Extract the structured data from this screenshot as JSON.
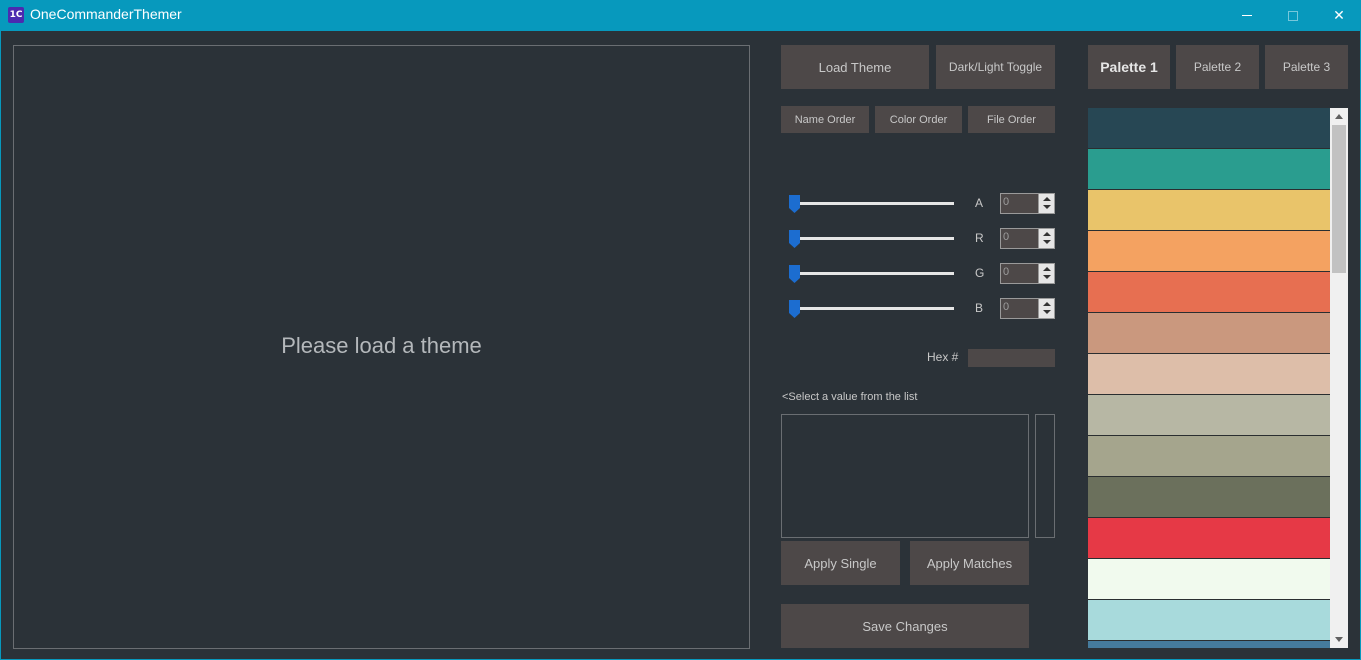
{
  "titlebar": {
    "app_icon_text": "1C",
    "title": "OneCommanderThemer",
    "close_glyph": "✕"
  },
  "preview": {
    "message": "Please load a theme"
  },
  "toolbar": {
    "load_theme": "Load Theme",
    "dark_light_toggle": "Dark/Light Toggle",
    "name_order": "Name Order",
    "color_order": "Color Order",
    "file_order": "File Order"
  },
  "sliders": {
    "a_label": "A",
    "a_value": "0",
    "r_label": "R",
    "r_value": "0",
    "g_label": "G",
    "g_value": "0",
    "b_label": "B",
    "b_value": "0"
  },
  "hex": {
    "label": "Hex #",
    "value": ""
  },
  "list": {
    "hint": "<Select a value from the list"
  },
  "actions": {
    "apply_single": "Apply Single",
    "apply_matches": "Apply Matches",
    "save_changes": "Save Changes"
  },
  "palette_tabs": {
    "tab1": "Palette 1",
    "tab2": "Palette 2",
    "tab3": "Palette 3",
    "active": "Palette 1"
  },
  "palette_colors": [
    "#274754",
    "#2a9d8f",
    "#e9c46a",
    "#f4a261",
    "#e76f51",
    "#ca987e",
    "#ddbea9",
    "#b7b7a4",
    "#a5a58d",
    "#6b705c",
    "#e63946",
    "#f1faee",
    "#a8dadc",
    "#457b9d"
  ],
  "colors": {
    "titlebar": "#0799bd",
    "background": "#2b3238",
    "button": "#4d4848",
    "slider_thumb": "#1c6dd0"
  }
}
